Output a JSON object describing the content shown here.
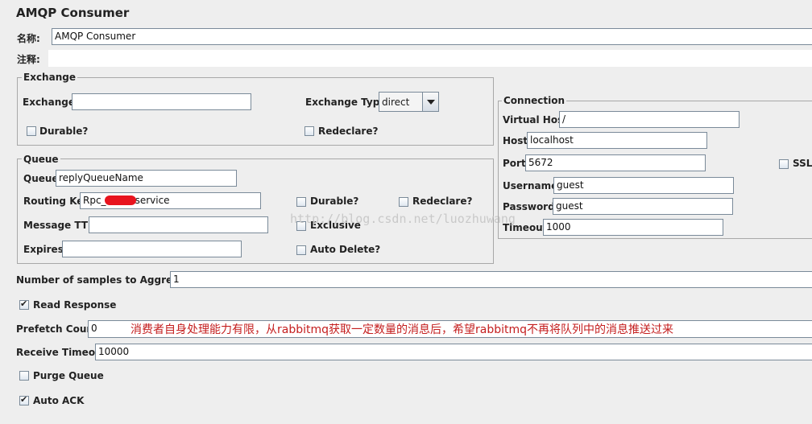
{
  "title": "AMQP Consumer",
  "name": {
    "label": "名称:",
    "value": "AMQP Consumer"
  },
  "comment": {
    "label": "注释:",
    "value": ""
  },
  "exchange": {
    "legend": "Exchange",
    "exchange_label": "Exchange",
    "exchange_value": "",
    "type_label": "Exchange Type",
    "type_value": "direct",
    "durable_label": "Durable?",
    "durable_checked": false,
    "redeclare_label": "Redeclare?",
    "redeclare_checked": false
  },
  "queue": {
    "legend": "Queue",
    "queue_label": "Queue",
    "queue_value": "replyQueueName",
    "routing_key_label": "Routing Key",
    "routing_key_prefix": "Rpc_",
    "routing_key_suffix": "service",
    "message_ttl_label": "Message TTL",
    "message_ttl_value": "",
    "expires_label": "Expires",
    "expires_value": "",
    "durable_label": "Durable?",
    "redeclare_label": "Redeclare?",
    "exclusive_label": "Exclusive",
    "auto_delete_label": "Auto Delete?"
  },
  "connection": {
    "legend": "Connection",
    "virtual_host_label": "Virtual Host",
    "virtual_host_value": "/",
    "host_label": "Host",
    "host_value": "localhost",
    "port_label": "Port",
    "port_value": "5672",
    "ssl_label": "SSL",
    "username_label": "Username",
    "username_value": "guest",
    "password_label": "Password",
    "password_value": "guest",
    "timeout_label": "Timeout",
    "timeout_value": "1000"
  },
  "samples": {
    "label": "Number of samples to Aggregate",
    "value": "1"
  },
  "read_response": {
    "label": "Read Response",
    "checked": true
  },
  "prefetch": {
    "label": "Prefetch Count",
    "value": "0",
    "note": "消费者自身处理能力有限，从rabbitmq获取一定数量的消息后，希望rabbitmq不再将队列中的消息推送过来"
  },
  "receive_timeout": {
    "label": "Receive Timeout",
    "value": "10000"
  },
  "purge_queue": {
    "label": "Purge Queue",
    "checked": false
  },
  "auto_ack": {
    "label": "Auto ACK",
    "checked": true
  },
  "watermark": "http://blog.csdn.net/luozhuwang",
  "colors": {
    "note": "#c41e1e",
    "redaction": "#e8141e",
    "background": "#eeeeee"
  }
}
